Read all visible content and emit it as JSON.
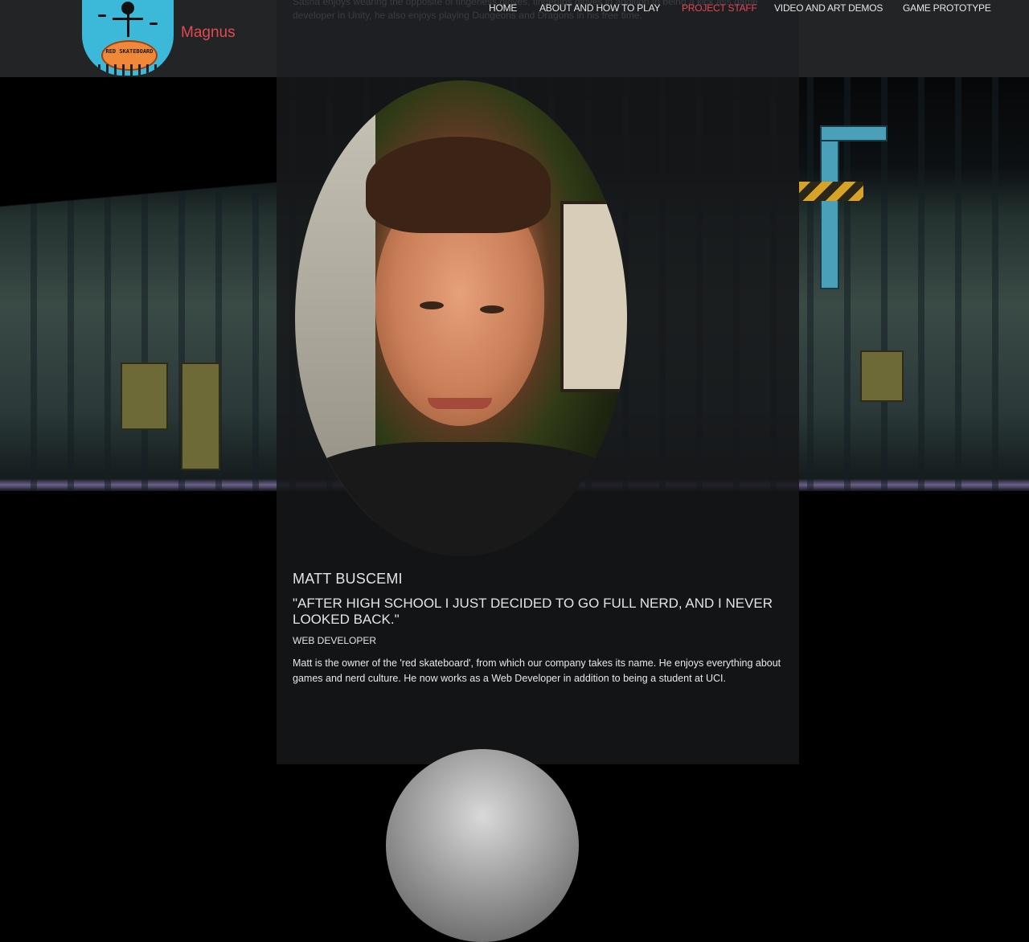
{
  "header": {
    "brand": "Magnus",
    "logo_text": "RED SKATEBOARD",
    "nav": [
      {
        "label": "HOME",
        "active": false
      },
      {
        "label": "ABOUT AND HOW TO PLAY",
        "active": false
      },
      {
        "label": "PROJECT STAFF",
        "active": true
      },
      {
        "label": "VIDEO AND ART DEMOS",
        "active": false
      },
      {
        "label": "GAME PROTOTYPE",
        "active": false
      }
    ],
    "previous_bio_tail": "Sasha enjoys wearing the opposite of fingerless gloves, fingertips gloves in addition to being a kick ass game developer in Unity, he also enjoys playing Dungeons and Dragons in his free time."
  },
  "staff": {
    "name": "MATT BUSCEMI",
    "quote": "\"AFTER HIGH SCHOOL I JUST DECIDED TO GO FULL NERD, AND I NEVER LOOKED BACK.\"",
    "role": "WEB DEVELOPER",
    "bio": "Matt is the owner of the 'red skateboard', from which our company takes its name. He enjoys everything about games and nerd culture. He now works as a Web Developer in addition to being a student at UCI."
  },
  "colors": {
    "accent": "#e24a50",
    "header_bg": "#222426",
    "column_bg": "#16171a"
  }
}
